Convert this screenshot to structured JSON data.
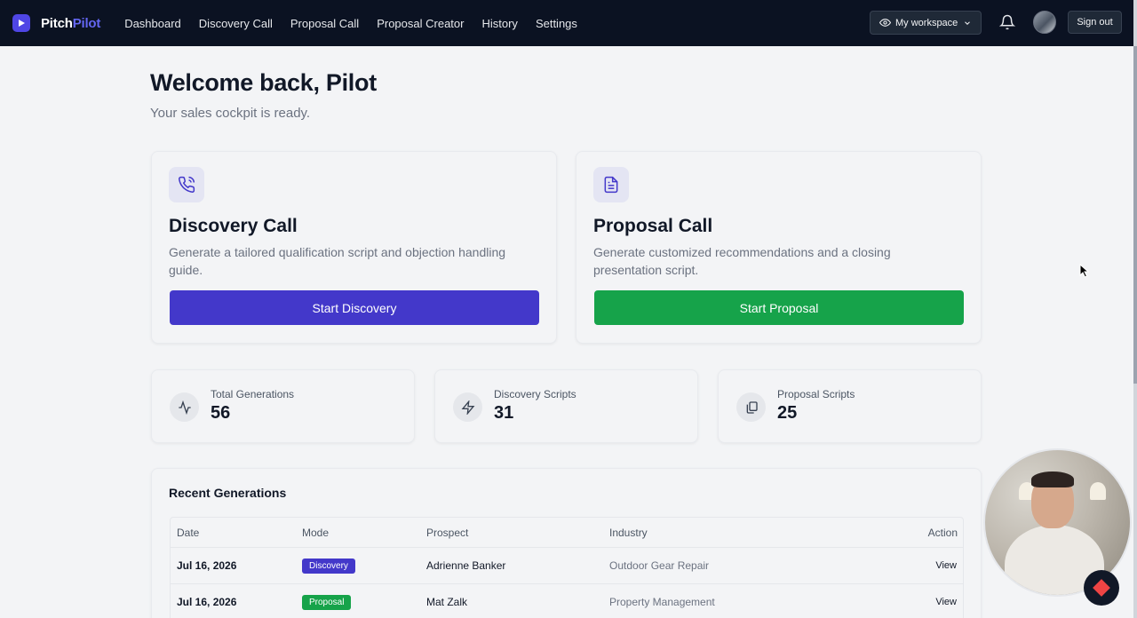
{
  "brand": {
    "name_part1": "Pitch",
    "name_part2": "Pilot"
  },
  "nav": {
    "items": [
      "Dashboard",
      "Discovery Call",
      "Proposal Call",
      "Proposal Creator",
      "History",
      "Settings"
    ]
  },
  "header": {
    "workspace_label": "My workspace",
    "signout_label": "Sign out"
  },
  "hero": {
    "title": "Welcome back, Pilot",
    "subtitle": "Your sales cockpit is ready."
  },
  "cards": {
    "discovery": {
      "icon": "phone-icon",
      "title": "Discovery Call",
      "description": "Generate a tailored qualification script and objection handling guide.",
      "button": "Start Discovery",
      "color": "#4338ca"
    },
    "proposal": {
      "icon": "document-icon",
      "title": "Proposal Call",
      "description": "Generate customized recommendations and a closing presentation script.",
      "button": "Start Proposal",
      "color": "#16a34a"
    }
  },
  "stats": [
    {
      "icon": "activity-icon",
      "label": "Total Generations",
      "value": "56"
    },
    {
      "icon": "bolt-icon",
      "label": "Discovery Scripts",
      "value": "31"
    },
    {
      "icon": "copy-icon",
      "label": "Proposal Scripts",
      "value": "25"
    }
  ],
  "recent": {
    "title": "Recent Generations",
    "columns": {
      "date": "Date",
      "mode": "Mode",
      "prospect": "Prospect",
      "industry": "Industry",
      "action": "Action"
    },
    "rows": [
      {
        "date": "Jul 16, 2026",
        "mode": "Discovery",
        "prospect": "Adrienne Banker",
        "industry": "Outdoor Gear Repair",
        "action": "View"
      },
      {
        "date": "Jul 16, 2026",
        "mode": "Proposal",
        "prospect": "Mat Zalk",
        "industry": "Property Management",
        "action": "View"
      }
    ]
  }
}
